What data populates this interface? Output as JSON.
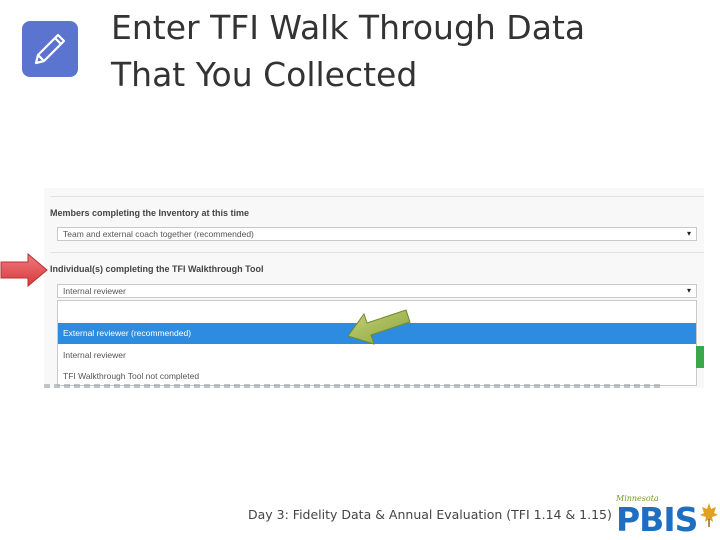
{
  "title": {
    "line1": "Enter TFI Walk Through Data",
    "line2": "That You Collected"
  },
  "icons": {
    "header": "pencil-icon"
  },
  "form": {
    "members_label": "Members completing the Inventory at this time",
    "members_value": "Team and external coach together (recommended)",
    "individual_label": "Individual(s) completing the TFI Walkthrough Tool",
    "individual_value": "Internal reviewer",
    "options": [
      "External reviewer (recommended)",
      "Internal reviewer",
      "TFI Walkthrough Tool not completed"
    ],
    "selected_option_index": 0,
    "caret_glyph": "▾"
  },
  "footer": {
    "text": "Day 3: Fidelity Data & Annual Evaluation (TFI 1.14 & 1.15)"
  },
  "logo": {
    "script": "Minnesota",
    "word": "PBIS"
  },
  "colors": {
    "icon_tile": "#5b74d0",
    "selected_option": "#2e8ce0",
    "red_arrow": "#e8474a",
    "green_arrow": "#9ab243",
    "logo_blue": "#1e6fc0"
  }
}
